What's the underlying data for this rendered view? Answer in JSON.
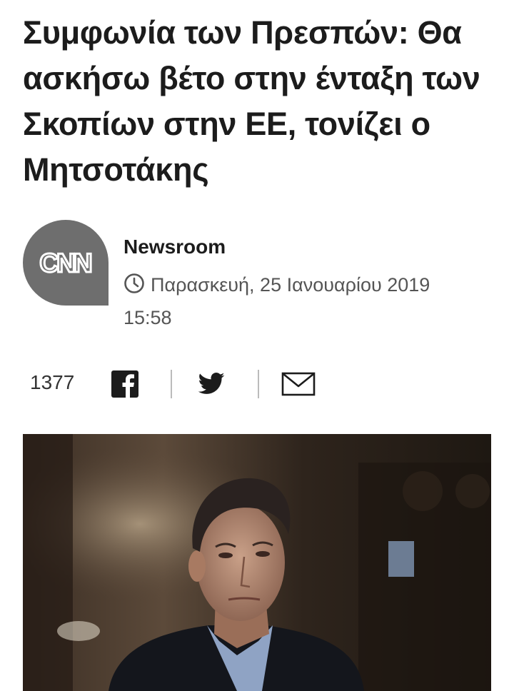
{
  "article": {
    "headline": "Συμφωνία των Πρεσπών: Θα ασκήσω βέτο στην ένταξη των Σκοπίων στην ΕΕ, τονίζει ο Μητσοτάκης"
  },
  "byline": {
    "logo_text": "CNN",
    "logo_color": "#6e6e6e",
    "author": "Newsroom",
    "date": "Παρασκευή, 25 Ιανουαρίου 2019",
    "time": "15:58",
    "clock_icon": "clock-icon"
  },
  "share": {
    "count": "1377",
    "buttons": [
      {
        "name": "facebook",
        "icon": "facebook-icon"
      },
      {
        "name": "twitter",
        "icon": "twitter-icon"
      },
      {
        "name": "email",
        "icon": "mail-icon"
      }
    ]
  },
  "hero_image": {
    "subject": "photo"
  }
}
